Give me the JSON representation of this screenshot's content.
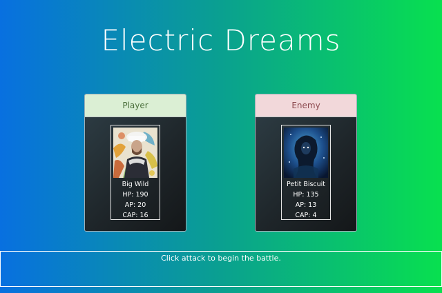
{
  "game": {
    "title": "Electric Dreams"
  },
  "player": {
    "header": "Player",
    "name": "Big Wild",
    "hp": "HP: 190",
    "ap": "AP: 20",
    "cap": "CAP: 16"
  },
  "enemy": {
    "header": "Enemy",
    "name": "Petit Biscuit",
    "hp": "HP: 135",
    "ap": "AP: 13",
    "cap": "CAP: 4"
  },
  "status": {
    "message": "Click attack to begin the battle."
  },
  "colors": {
    "background_start": "#0870e0",
    "background_end": "#08e04f",
    "player_header_bg": "#dbefd4",
    "enemy_header_bg": "#f2d8da",
    "panel_bg": "#1e2529"
  }
}
